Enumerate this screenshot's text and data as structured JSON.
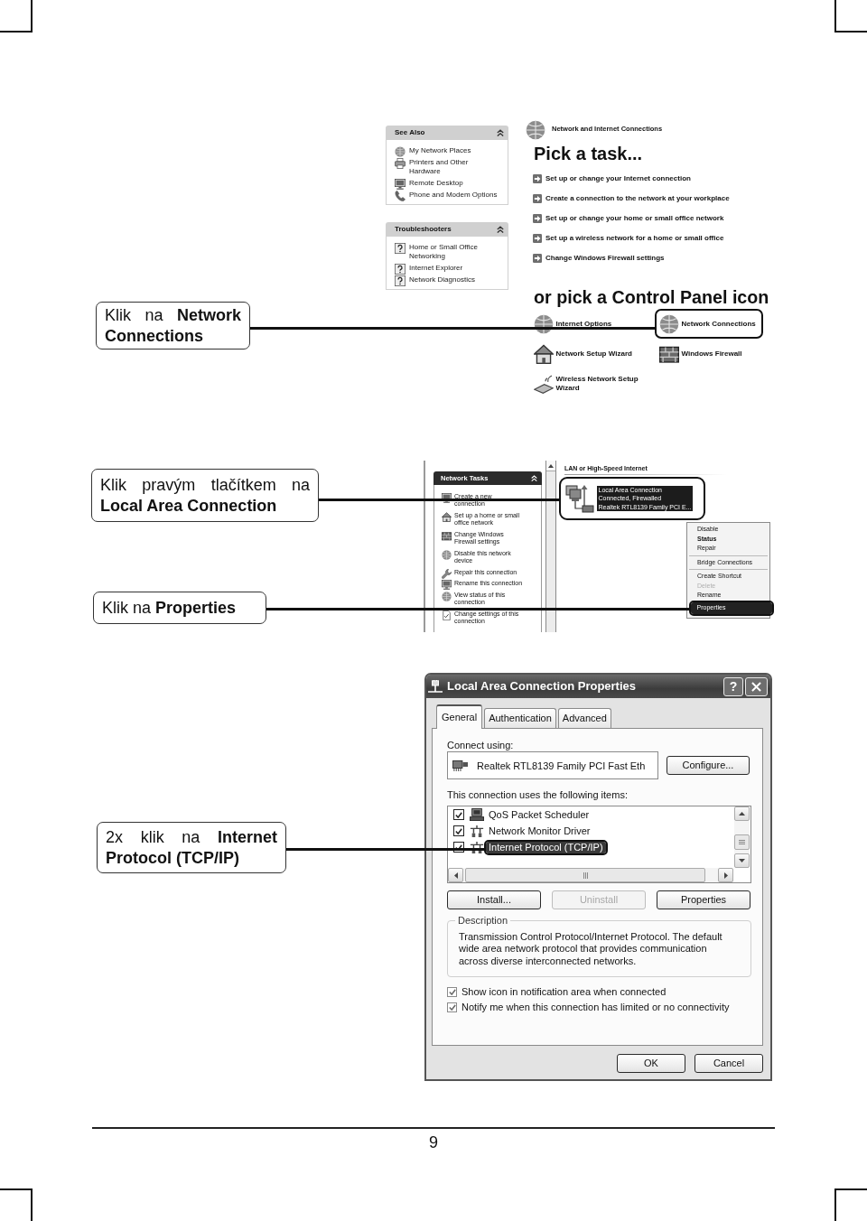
{
  "control_panel": {
    "callout": "Klik na **Network Connections**",
    "see_also": {
      "title": "See Also",
      "items": [
        "My Network Places",
        "Printers and Other Hardware",
        "Remote Desktop",
        "Phone and Modem Options"
      ]
    },
    "troubleshooters": {
      "title": "Troubleshooters",
      "items": [
        "Home or Small Office Networking",
        "Internet Explorer",
        "Network Diagnostics"
      ]
    },
    "category": "Network and Internet Connections",
    "task_heading": "Pick a task...",
    "tasks": [
      "Set up or change your Internet connection",
      "Create a connection to the network at your workplace",
      "Set up or change your home or small office network",
      "Set up a wireless network for a home or small office",
      "Change Windows Firewall settings"
    ],
    "icon_heading": "or pick a Control Panel icon",
    "icons": [
      {
        "label": "Internet Options",
        "highlighted": false
      },
      {
        "label": "Network Connections",
        "highlighted": true
      },
      {
        "label": "Network Setup Wizard",
        "highlighted": false
      },
      {
        "label": "Windows Firewall",
        "highlighted": false
      },
      {
        "label": "Wireless Network Setup Wizard",
        "highlighted": false
      }
    ]
  },
  "network_connections": {
    "callouts": [
      "Klik pravým tlačítkem na **Local Area Connection**",
      "Klik na **Properties**"
    ],
    "tasks_panel": {
      "title": "Network Tasks",
      "items": [
        "Create a new connection",
        "Set up a home or small office network",
        "Change Windows Firewall settings",
        "Disable this network device",
        "Repair this connection",
        "Rename this connection",
        "View status of this connection",
        "Change settings of this connection"
      ]
    },
    "group_heading": "LAN or High-Speed Internet",
    "connection": {
      "name": "Local Area Connection",
      "status": "Connected, Firewalled",
      "device": "Realtek RTL8139 Family PCI E...",
      "selected": true,
      "highlighted": true
    },
    "context_menu": [
      {
        "kind": "item",
        "label": "Disable",
        "default": false,
        "disabled": false,
        "selected": false,
        "highlighted": false
      },
      {
        "kind": "item",
        "label": "Status",
        "default": true,
        "disabled": false,
        "selected": false,
        "highlighted": false
      },
      {
        "kind": "item",
        "label": "Repair",
        "default": false,
        "disabled": false,
        "selected": false,
        "highlighted": false
      },
      {
        "kind": "separator"
      },
      {
        "kind": "item",
        "label": "Bridge Connections",
        "default": false,
        "disabled": false,
        "selected": false,
        "highlighted": false
      },
      {
        "kind": "separator"
      },
      {
        "kind": "item",
        "label": "Create Shortcut",
        "default": false,
        "disabled": false,
        "selected": false,
        "highlighted": false
      },
      {
        "kind": "item",
        "label": "Delete",
        "default": false,
        "disabled": true,
        "selected": false,
        "highlighted": false
      },
      {
        "kind": "item",
        "label": "Rename",
        "default": false,
        "disabled": false,
        "selected": false,
        "highlighted": false
      },
      {
        "kind": "item",
        "label": "Properties",
        "default": false,
        "disabled": false,
        "selected": true,
        "highlighted": true
      }
    ]
  },
  "properties_dialog": {
    "callout": "2x klik na **Internet Protocol (TCP/IP)**",
    "title": "Local Area Connection Properties",
    "help_button": "?",
    "tabs": [
      {
        "label": "General",
        "selected": true
      },
      {
        "label": "Authentication",
        "selected": false
      },
      {
        "label": "Advanced",
        "selected": false
      }
    ],
    "connect_using_label": "Connect using:",
    "adapter": "Realtek RTL8139 Family PCI Fast Eth",
    "configure_button": "Configure...",
    "items_label": "This connection uses the following items:",
    "items": [
      {
        "label": "QoS Packet Scheduler",
        "checked": true,
        "selected": false,
        "highlighted": false
      },
      {
        "label": "Network Monitor Driver",
        "checked": true,
        "selected": false,
        "highlighted": false
      },
      {
        "label": "Internet Protocol (TCP/IP)",
        "checked": true,
        "selected": true,
        "highlighted": true
      }
    ],
    "buttons": [
      {
        "label": "Install...",
        "disabled": false
      },
      {
        "label": "Uninstall",
        "disabled": true
      },
      {
        "label": "Properties",
        "disabled": false
      }
    ],
    "description_title": "Description",
    "description": "Transmission Control Protocol/Internet Protocol. The default wide area network protocol that provides communication across diverse interconnected networks.",
    "options": [
      {
        "label": "Show icon in notification area when connected",
        "checked": true
      },
      {
        "label": "Notify me when this connection has limited or no connectivity",
        "checked": true
      }
    ],
    "dialog_buttons": [
      "OK",
      "Cancel"
    ]
  },
  "page_number": "9"
}
